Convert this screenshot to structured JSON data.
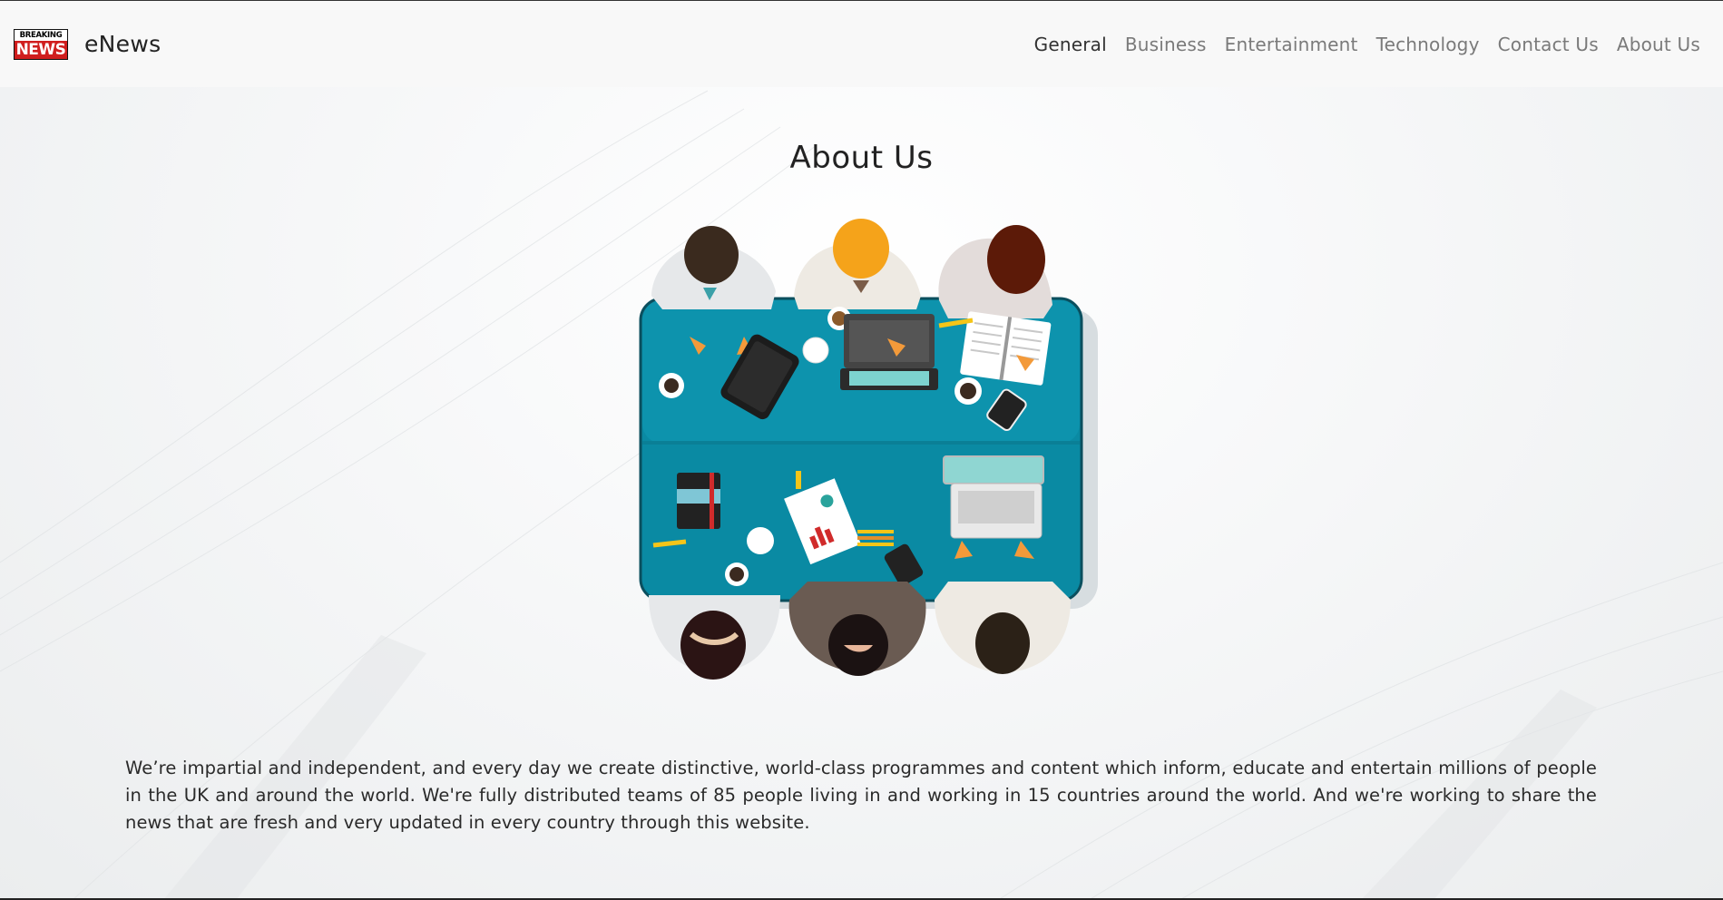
{
  "brand": {
    "logo_top": "BREAKING",
    "logo_bottom": "NEWS",
    "name": "eNews"
  },
  "nav": {
    "items": [
      {
        "label": "General",
        "active": true
      },
      {
        "label": "Business",
        "active": false
      },
      {
        "label": "Entertainment",
        "active": false
      },
      {
        "label": "Technology",
        "active": false
      },
      {
        "label": "Contact Us",
        "active": false
      },
      {
        "label": "About Us",
        "active": false
      }
    ]
  },
  "page": {
    "title": "About Us",
    "illustration": "team-meeting-table-illustration",
    "body": "We’re impartial and independent, and every day we create distinctive, world-class programmes and content which inform, educate and entertain millions of people in the UK and around the world. We're fully distributed teams of 85 people living in and working in 15 countries around the world. And we're working to share the news that are fresh and very updated in every country through this website."
  },
  "colors": {
    "logo_red": "#d01e1e",
    "table_teal": "#0a8aa3",
    "nav_active": "#333333",
    "nav_inactive": "#7a7a7a"
  }
}
